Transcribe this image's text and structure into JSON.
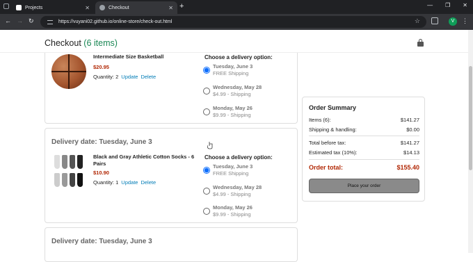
{
  "browser": {
    "tabs": [
      {
        "label": "Projects"
      },
      {
        "label": "Checkout"
      }
    ],
    "url": "https://vuyani02.github.io/online-store/check-out.html",
    "profile_initial": "V"
  },
  "header": {
    "title": "Checkout",
    "count": "6 items",
    "open_paren": "(",
    "close_paren": ")"
  },
  "items": [
    {
      "delivery": "",
      "name": "Intermediate Size Basketball",
      "price": "$20.95",
      "quantity": "Quantity: 2",
      "update": "Update",
      "delete": "Delete",
      "options_title": "Choose a delivery option:",
      "options": [
        {
          "date": "Tuesday, June 3",
          "price": "FREE Shipping",
          "selected": true
        },
        {
          "date": "Wednesday, May 28",
          "price": "$4.99 - Shipping",
          "selected": false
        },
        {
          "date": "Monday, May 26",
          "price": "$9.99 - Shipping",
          "selected": false
        }
      ]
    },
    {
      "delivery": "Delivery date: Tuesday, June 3",
      "name": "Black and Gray Athletic Cotton Socks - 6 Pairs",
      "price": "$10.90",
      "quantity": "Quantity: 1",
      "update": "Update",
      "delete": "Delete",
      "options_title": "Choose a delivery option:",
      "options": [
        {
          "date": "Tuesday, June 3",
          "price": "FREE Shipping",
          "selected": true
        },
        {
          "date": "Wednesday, May 28",
          "price": "$4.99 - Shipping",
          "selected": false
        },
        {
          "date": "Monday, May 26",
          "price": "$9.99 - Shipping",
          "selected": false
        }
      ]
    },
    {
      "delivery": "Delivery date: Tuesday, June 3"
    }
  ],
  "summary": {
    "title": "Order Summary",
    "rows": [
      {
        "label": "Items (6):",
        "value": "$141.27"
      },
      {
        "label": "Shipping & handling:",
        "value": "$0.00"
      },
      {
        "label": "Total before tax:",
        "value": "$141.27"
      },
      {
        "label": "Estimated tax (10%):",
        "value": "$14.13"
      }
    ],
    "total_label": "Order total:",
    "total_value": "$155.40",
    "button": "Place your order"
  },
  "colors": {
    "price_red": "#b12704",
    "link_blue": "#017cb6",
    "count_green": "#198754",
    "radio_blue": "#0d6efd"
  },
  "icons": [
    "lock-icon",
    "basketball-image",
    "socks-image",
    "hand-cursor-icon"
  ]
}
